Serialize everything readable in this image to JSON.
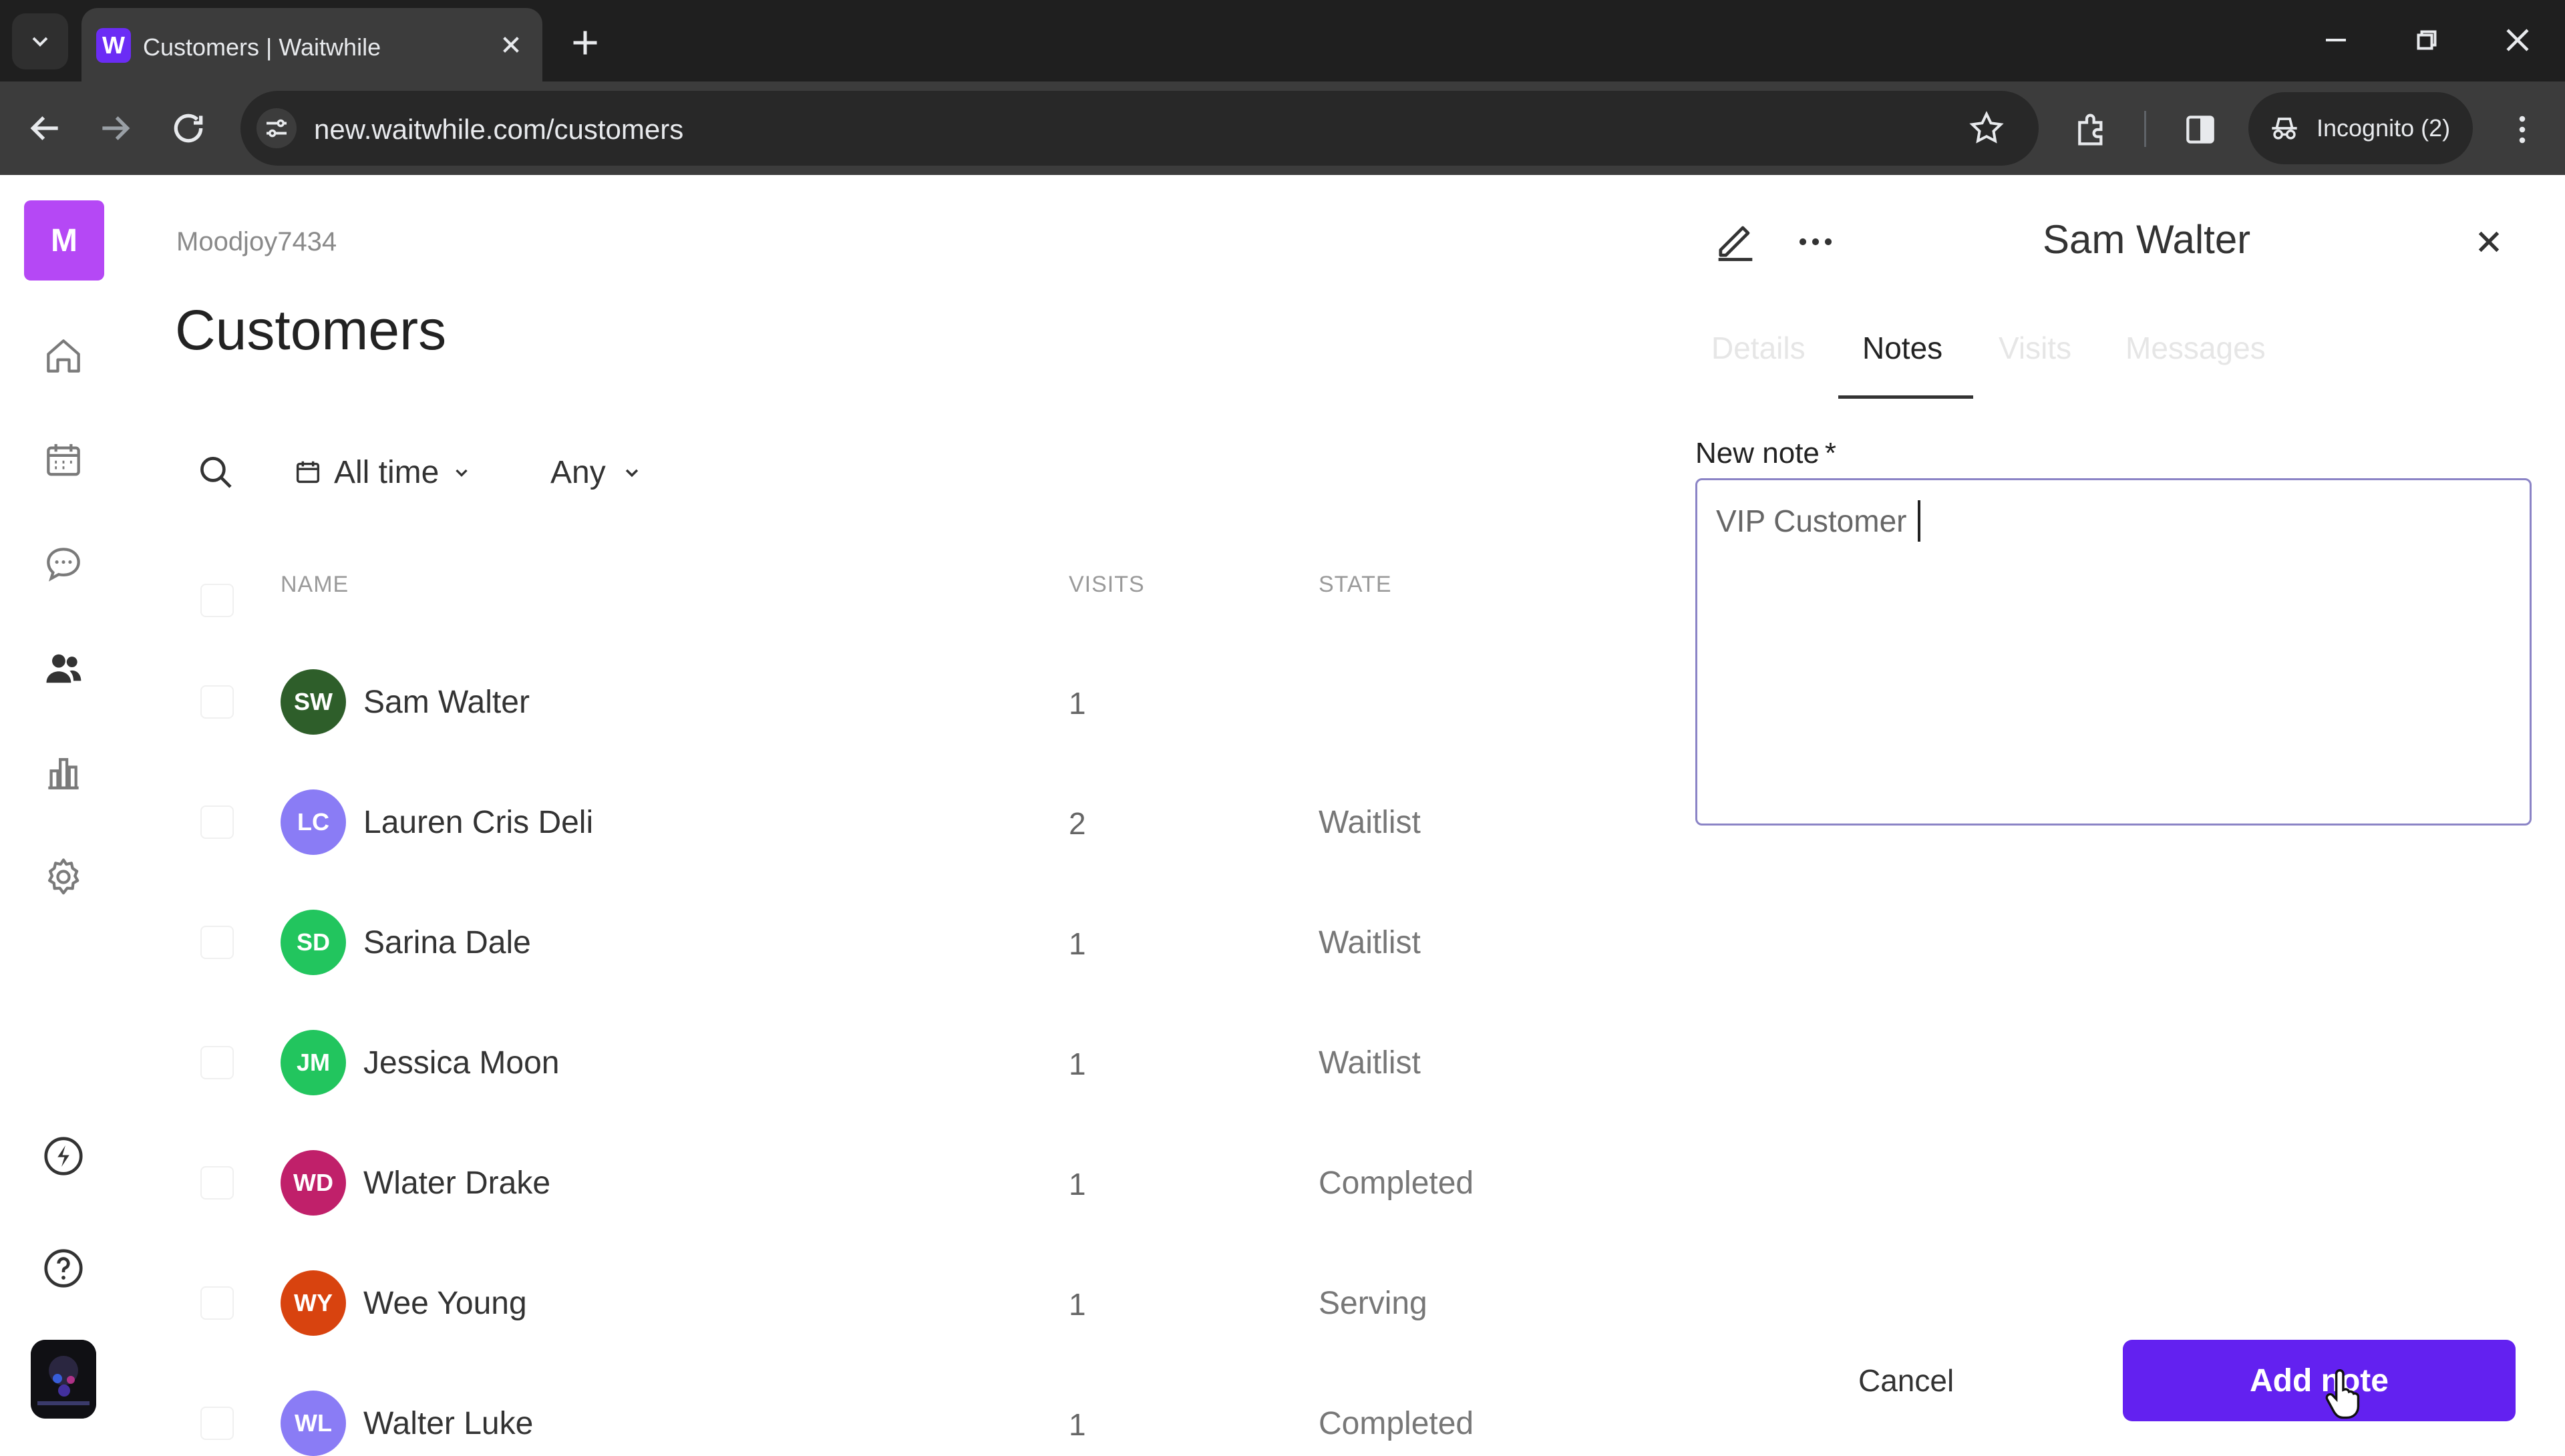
{
  "browser": {
    "tab_title": "Customers | Waitwhile",
    "url": "new.waitwhile.com/customers",
    "profile_label": "Incognito (2)"
  },
  "sidebar": {
    "org_initial": "M",
    "items": [
      {
        "icon": "home-icon"
      },
      {
        "icon": "calendar-icon"
      },
      {
        "icon": "chat-icon"
      },
      {
        "icon": "customers-icon"
      },
      {
        "icon": "analytics-icon"
      },
      {
        "icon": "settings-icon"
      }
    ],
    "bottom_items": [
      {
        "icon": "lightning-icon"
      },
      {
        "icon": "help-icon"
      },
      {
        "icon": "user-avatar"
      }
    ]
  },
  "main": {
    "breadcrumb": "Moodjoy7434",
    "title": "Customers",
    "filters": {
      "date_label": "All time",
      "state_label": "Any"
    },
    "table": {
      "columns": [
        "NAME",
        "VISITS",
        "STATE"
      ],
      "rows": [
        {
          "initials": "SW",
          "name": "Sam Walter",
          "visits": "1",
          "state": "",
          "color": "#2e5e2a"
        },
        {
          "initials": "LC",
          "name": "Lauren Cris Deli",
          "visits": "2",
          "state": "Waitlist",
          "color": "#8a7cf5"
        },
        {
          "initials": "SD",
          "name": "Sarina Dale",
          "visits": "1",
          "state": "Waitlist",
          "color": "#22c55e"
        },
        {
          "initials": "JM",
          "name": "Jessica Moon",
          "visits": "1",
          "state": "Waitlist",
          "color": "#22c55e"
        },
        {
          "initials": "WD",
          "name": "Wlater Drake",
          "visits": "1",
          "state": "Completed",
          "color": "#c0206a"
        },
        {
          "initials": "WY",
          "name": "Wee Young",
          "visits": "1",
          "state": "Serving",
          "color": "#d8430f"
        },
        {
          "initials": "WL",
          "name": "Walter Luke",
          "visits": "1",
          "state": "Completed",
          "color": "#8a7cf5"
        }
      ]
    }
  },
  "panel": {
    "customer_name": "Sam Walter",
    "tabs": [
      "Details",
      "Notes",
      "Visits",
      "Messages"
    ],
    "active_tab": "Notes",
    "note_label": "New note",
    "required_mark": "*",
    "note_value": "VIP Customer",
    "cancel_label": "Cancel",
    "add_label": "Add note"
  },
  "colors": {
    "accent": "#6321f0",
    "org_badge": "#b548f5"
  }
}
